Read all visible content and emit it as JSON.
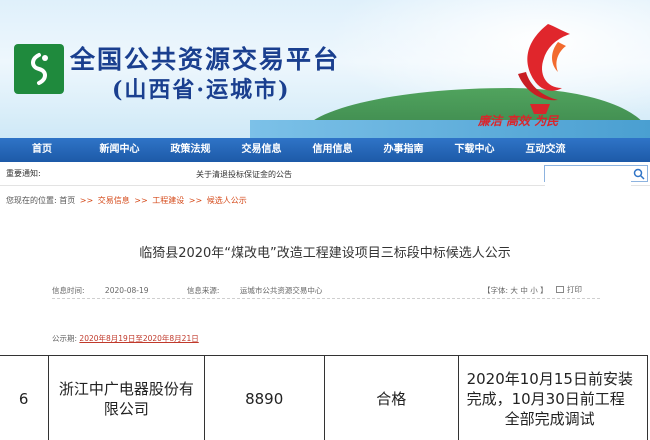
{
  "header": {
    "title": "全国公共资源交易平台",
    "subtitle": "(山西省·运城市)",
    "slogan": "廉洁 高效 为民"
  },
  "nav": {
    "items": [
      "首页",
      "新闻中心",
      "政策法规",
      "交易信息",
      "信用信息",
      "办事指南",
      "下载中心",
      "互动交流"
    ]
  },
  "notice": {
    "label": "重要通知:",
    "message": "关于清退投标保证金的公告"
  },
  "search": {
    "placeholder": "",
    "icon": "search-icon"
  },
  "breadcrumb": {
    "prefix": "您现在的位置:",
    "items": [
      "首页",
      "交易信息",
      "工程建设",
      "候选人公示"
    ],
    "separator": ">>"
  },
  "article": {
    "title": "临猗县2020年“煤改电”改造工程建设项目三标段中标候选人公示",
    "date_label": "信息时间:",
    "date": "2020-08-19",
    "source_label": "信息来源:",
    "source": "运城市公共资源交易中心",
    "font_label": "【字体:",
    "font_options": [
      "大",
      "中",
      "小"
    ],
    "font_end": "】",
    "print_label": "打印",
    "period_label": "公示期:",
    "period_value": "2020年8月19日至2020年8月21日"
  },
  "table": {
    "rows": [
      {
        "index": "6",
        "company": "浙江中广电器股份有限公司",
        "price": "8890",
        "status": "合格",
        "plan_lines": [
          "2020年10月15日前安装",
          "完成，10月30日前工程",
          "全部完成调试"
        ]
      }
    ]
  },
  "colors": {
    "nav_bg": "#1d5aa8",
    "title_blue": "#1a3f8f",
    "accent_red": "#d8262b",
    "logo_green": "#1f8a3d"
  }
}
